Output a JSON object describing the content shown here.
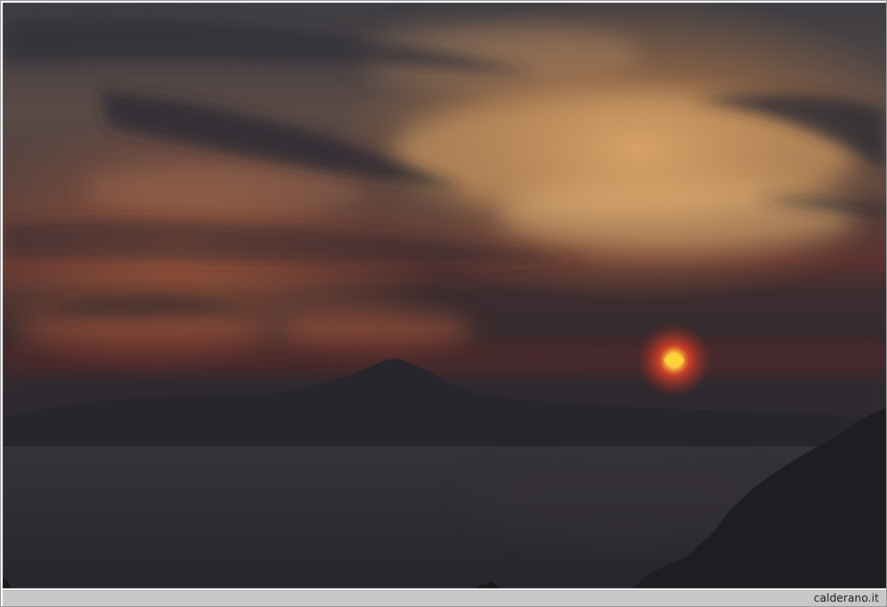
{
  "photo": {
    "subject": "sunset-over-sea",
    "colors": {
      "sky_top": "#3c3b41",
      "sky_glow": "#b8753f",
      "horizon_red": "#7a2a22",
      "sun": "#ffd23a",
      "sea": "#2a2b31",
      "silhouette": "#1f1f25"
    }
  },
  "footer": {
    "credit": "calderano.it"
  }
}
